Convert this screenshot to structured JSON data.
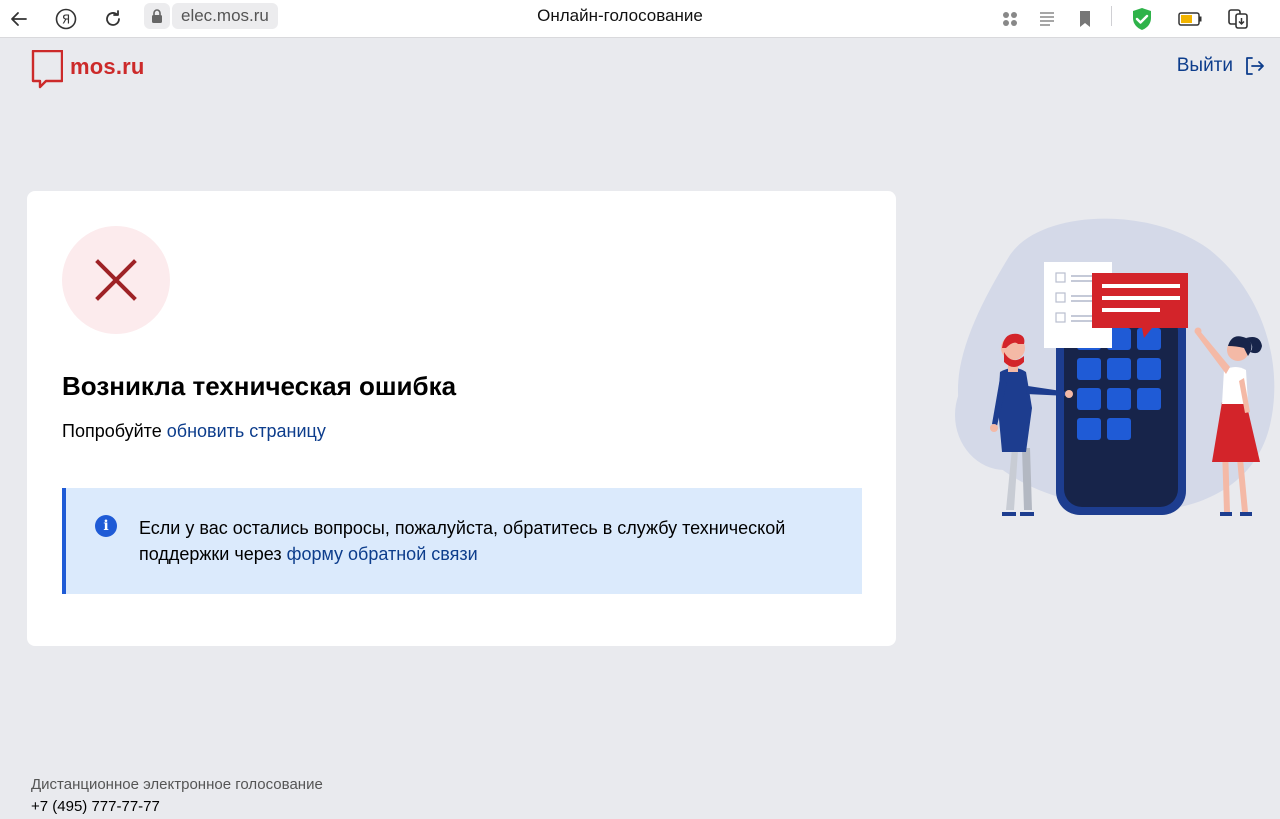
{
  "browser": {
    "url": "elec.mos.ru",
    "tab_title": "Онлайн-голосование",
    "icons": [
      "back-arrow-icon",
      "yandex-icon",
      "reload-icon",
      "lock-icon",
      "apps-icon",
      "reader-mode-icon",
      "bookmark-icon",
      "shield-check-icon",
      "battery-icon",
      "downloads-icon"
    ]
  },
  "header": {
    "logo_text": "mos.ru",
    "logout_label": "Выйти"
  },
  "error": {
    "title": "Возникла техническая ошибка",
    "subtitle_prefix": "Попробуйте ",
    "refresh_link": "обновить страницу"
  },
  "info": {
    "text_prefix": "Если у вас остались вопросы, пожалуйста, обратитесь в службу технической поддержки через ",
    "feedback_link": "форму обратной связи"
  },
  "footer": {
    "title": "Дистанционное электронное голосование",
    "phone": "+7 (495) 777-77-77"
  },
  "colors": {
    "brand_red": "#cc2a2a",
    "link_blue": "#0d3d8c",
    "info_bg": "#dbeafc",
    "info_accent": "#1f5bd6",
    "error_circle_bg": "#fcebed",
    "error_cross": "#9e2226"
  }
}
